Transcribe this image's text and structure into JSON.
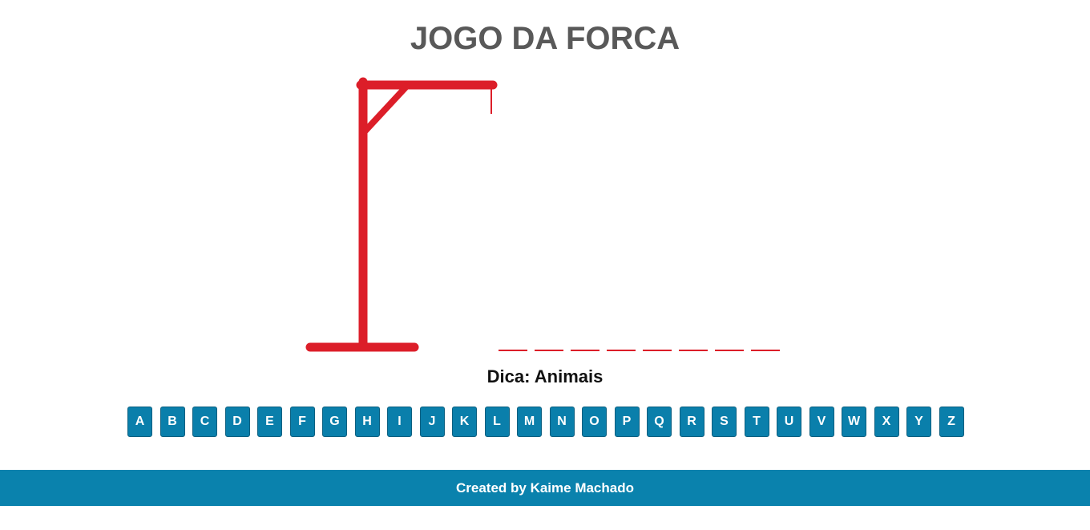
{
  "header": {
    "title": "JOGO DA FORCA"
  },
  "game": {
    "word_length": 8,
    "revealed_letters": [
      "",
      "",
      "",
      "",
      "",
      "",
      "",
      ""
    ],
    "hint": "Dica: Animais",
    "wrong_guesses": 0
  },
  "keyboard": {
    "letters": [
      "A",
      "B",
      "C",
      "D",
      "E",
      "F",
      "G",
      "H",
      "I",
      "J",
      "K",
      "L",
      "M",
      "N",
      "O",
      "P",
      "Q",
      "R",
      "S",
      "T",
      "U",
      "V",
      "W",
      "X",
      "Y",
      "Z"
    ]
  },
  "footer": {
    "credit": "Created by Kaime Machado"
  },
  "colors": {
    "gallows": "#dc1e29",
    "key_background": "#0a7fab",
    "footer_background": "#0a82ad",
    "title": "#595959"
  }
}
